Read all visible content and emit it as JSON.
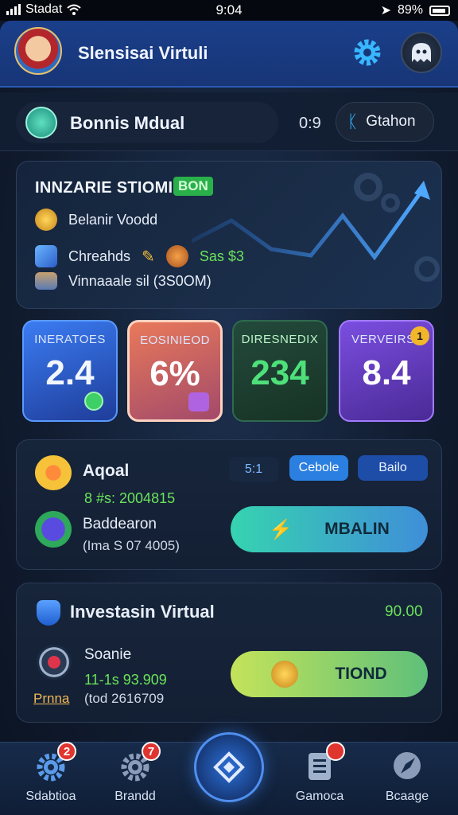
{
  "status_bar": {
    "carrier": "Stadat",
    "time": "9:04",
    "battery": "89%"
  },
  "header": {
    "title": "Slensisai Virtuli",
    "icons": {
      "settings": "gear-icon",
      "profile": "ghost-avatar-icon"
    }
  },
  "balance": {
    "label": "Bonnis Mdual",
    "value": "0:9",
    "station_label": "Gtahon"
  },
  "chart_card": {
    "title": "INNZARIE STIOMI",
    "tag": "BON",
    "rows": [
      {
        "icon": "gold-coin-icon",
        "label": "Belanir Voodd"
      },
      {
        "icon": "cash-stack-icon",
        "label": "Chreahds",
        "extra": "Sas $3"
      },
      {
        "icon": "books-icon",
        "label": "Vinnaaale sil (3S0OM)"
      }
    ]
  },
  "tiles": [
    {
      "label": "INERATOES",
      "value": "2.4",
      "color": "#3a6ff0"
    },
    {
      "label": "EOSINIEOD",
      "value": "6%",
      "color": "#e9795a"
    },
    {
      "label": "DIRESNEDIX",
      "value": "234",
      "color": "#3ecf67"
    },
    {
      "label": "VERVEIRS",
      "value": "8.4",
      "color": "#7a4ad8",
      "badge": "1"
    }
  ],
  "action_card_1": {
    "title": "Aqoal",
    "subtitle_value": "8 #s: 2004815",
    "chip_1": "5:1",
    "chip_2": "Cebole",
    "chip_3": "Bailo",
    "item_title": "Baddearon",
    "item_detail": "(Ima S 07 4005)",
    "button_label": "MBALIN"
  },
  "action_card_2": {
    "title": "Investasin Virtual",
    "value": "90.00",
    "item_title": "Soanie",
    "item_value": "11-1s 93.909",
    "item_badge": "Prnna",
    "item_detail": "(tod 2616709",
    "button_label": "TIOND"
  },
  "bottom_nav": [
    {
      "label": "Sdabtioa",
      "icon": "gear-icon",
      "badge": "2"
    },
    {
      "label": "Brandd",
      "icon": "gear-icon",
      "badge": "7"
    },
    {
      "label": "Gamoca",
      "icon": "clipboard-icon",
      "badge": ""
    },
    {
      "label": "Bcaage",
      "icon": "compass-icon",
      "badge": ""
    }
  ],
  "colors": {
    "accent": "#2ab04a",
    "primary": "#1a3f8a",
    "teal": "#2fc3a8",
    "lime": "#9ed65a"
  }
}
